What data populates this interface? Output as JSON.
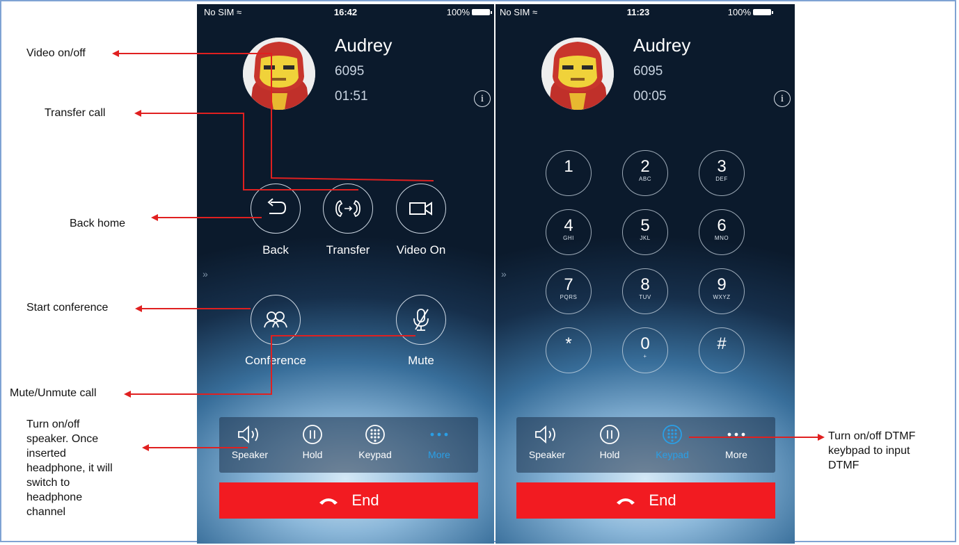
{
  "annotations": {
    "video": "Video on/off",
    "transfer": "Transfer call",
    "back": "Back home",
    "conference": "Start conference",
    "mute": "Mute/Unmute call",
    "speaker_lines": [
      "Turn on/off",
      "speaker. Once",
      "inserted",
      "headphone, it will",
      "switch to",
      "headphone",
      "channel"
    ],
    "dtmf_lines": [
      "Turn on/off DTMF",
      "keybpad to input",
      "DTMF"
    ]
  },
  "colors": {
    "annotation_arrow": "#e02020",
    "end_button": "#f21b21",
    "active_tab": "#2a9fe6"
  },
  "left_screen": {
    "status": {
      "carrier": "No SIM",
      "time": "16:42",
      "battery": "100%"
    },
    "contact": {
      "name": "Audrey",
      "number": "6095",
      "duration": "01:51"
    },
    "info_label": "i",
    "controls": {
      "back": "Back",
      "transfer": "Transfer",
      "video": "Video On",
      "conference": "Conference",
      "mute": "Mute"
    },
    "toolbar": {
      "speaker": "Speaker",
      "hold": "Hold",
      "keypad": "Keypad",
      "more": "More",
      "active": "more"
    },
    "end_label": "End"
  },
  "right_screen": {
    "status": {
      "carrier": "No SIM",
      "time": "11:23",
      "battery": "100%"
    },
    "contact": {
      "name": "Audrey",
      "number": "6095",
      "duration": "00:05"
    },
    "info_label": "i",
    "keypad": [
      {
        "digit": "1",
        "letters": ""
      },
      {
        "digit": "2",
        "letters": "ABC"
      },
      {
        "digit": "3",
        "letters": "DEF"
      },
      {
        "digit": "4",
        "letters": "GHI"
      },
      {
        "digit": "5",
        "letters": "JKL"
      },
      {
        "digit": "6",
        "letters": "MNO"
      },
      {
        "digit": "7",
        "letters": "PQRS"
      },
      {
        "digit": "8",
        "letters": "TUV"
      },
      {
        "digit": "9",
        "letters": "WXYZ"
      },
      {
        "digit": "*",
        "letters": ""
      },
      {
        "digit": "0",
        "letters": "+"
      },
      {
        "digit": "#",
        "letters": ""
      }
    ],
    "toolbar": {
      "speaker": "Speaker",
      "hold": "Hold",
      "keypad": "Keypad",
      "more": "More",
      "active": "keypad"
    },
    "end_label": "End"
  }
}
